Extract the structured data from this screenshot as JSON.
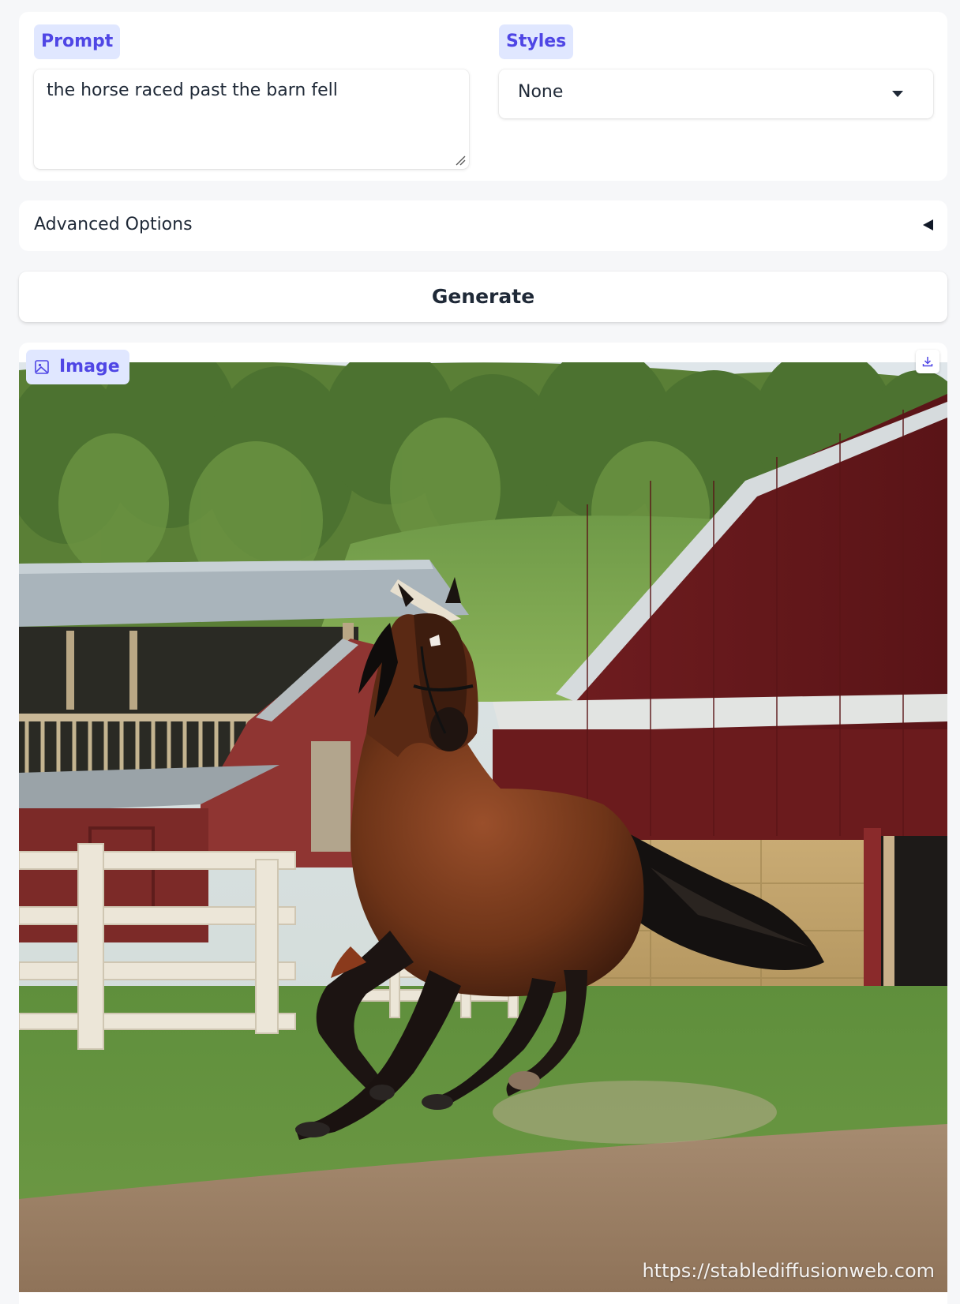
{
  "prompt": {
    "label": "Prompt",
    "value": "the horse raced past the barn fell"
  },
  "styles": {
    "label": "Styles",
    "selected": "None"
  },
  "advanced_options": {
    "label": "Advanced Options"
  },
  "generate": {
    "label": "Generate"
  },
  "output": {
    "label": "Image",
    "watermark": "https://stablediffusionweb.com",
    "icons": [
      "image-icon",
      "download-icon"
    ]
  },
  "colors": {
    "label_bg": "#e0e7ff",
    "label_text": "#4f46e5",
    "page_bg": "#f6f7f9"
  }
}
